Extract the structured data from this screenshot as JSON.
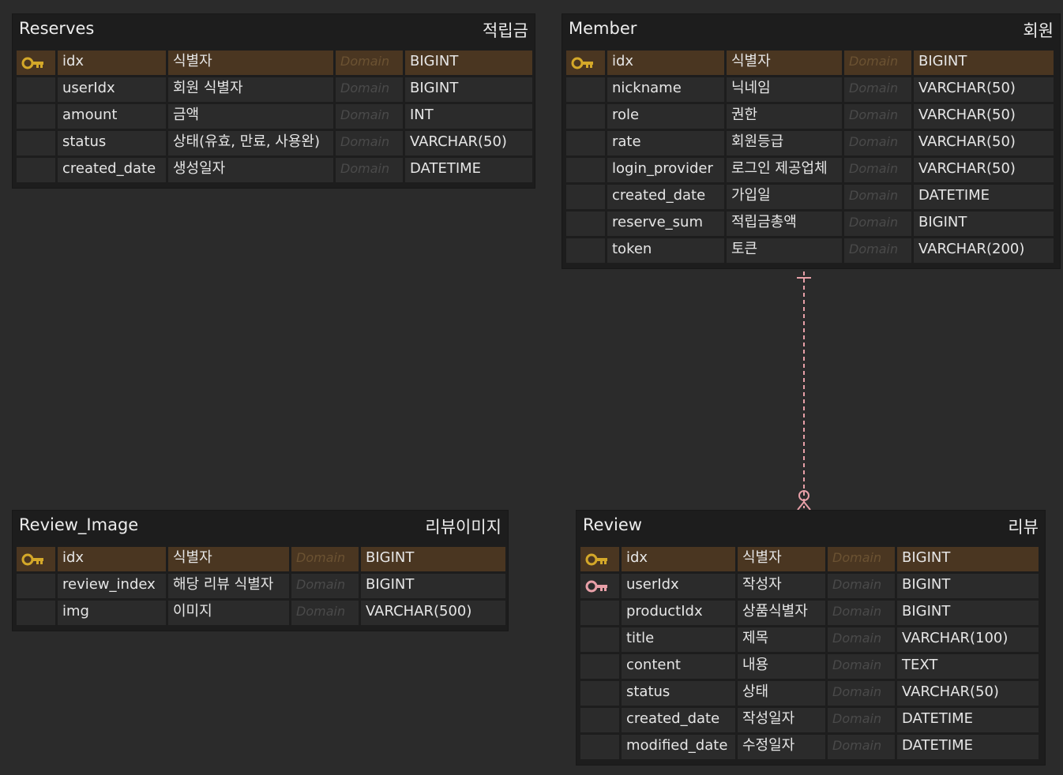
{
  "entities": {
    "reserves": {
      "name": "Reserves",
      "logical_name": "적립금",
      "columns": [
        {
          "name": "idx",
          "logical": "식별자",
          "domain": "Domain",
          "type": "BIGINT",
          "key": "pk"
        },
        {
          "name": "userIdx",
          "logical": "회원 식별자",
          "domain": "Domain",
          "type": "BIGINT",
          "key": ""
        },
        {
          "name": "amount",
          "logical": "금액",
          "domain": "Domain",
          "type": "INT",
          "key": ""
        },
        {
          "name": "status",
          "logical": "상태(유효, 만료, 사용완)",
          "domain": "Domain",
          "type": "VARCHAR(50)",
          "key": ""
        },
        {
          "name": "created_date",
          "logical": "생성일자",
          "domain": "Domain",
          "type": "DATETIME",
          "key": ""
        }
      ]
    },
    "member": {
      "name": "Member",
      "logical_name": "회원",
      "columns": [
        {
          "name": "idx",
          "logical": "식별자",
          "domain": "Domain",
          "type": "BIGINT",
          "key": "pk"
        },
        {
          "name": "nickname",
          "logical": "닉네임",
          "domain": "Domain",
          "type": "VARCHAR(50)",
          "key": ""
        },
        {
          "name": "role",
          "logical": "권한",
          "domain": "Domain",
          "type": "VARCHAR(50)",
          "key": ""
        },
        {
          "name": "rate",
          "logical": "회원등급",
          "domain": "Domain",
          "type": "VARCHAR(50)",
          "key": ""
        },
        {
          "name": "login_provider",
          "logical": "로그인 제공업체",
          "domain": "Domain",
          "type": "VARCHAR(50)",
          "key": ""
        },
        {
          "name": "created_date",
          "logical": "가입일",
          "domain": "Domain",
          "type": "DATETIME",
          "key": ""
        },
        {
          "name": "reserve_sum",
          "logical": "적립금총액",
          "domain": "Domain",
          "type": "BIGINT",
          "key": ""
        },
        {
          "name": "token",
          "logical": "토큰",
          "domain": "Domain",
          "type": "VARCHAR(200)",
          "key": ""
        }
      ]
    },
    "review_image": {
      "name": "Review_Image",
      "logical_name": "리뷰이미지",
      "columns": [
        {
          "name": "idx",
          "logical": "식별자",
          "domain": "Domain",
          "type": "BIGINT",
          "key": "pk"
        },
        {
          "name": "review_index",
          "logical": "해당 리뷰 식별자",
          "domain": "Domain",
          "type": "BIGINT",
          "key": ""
        },
        {
          "name": "img",
          "logical": "이미지",
          "domain": "Domain",
          "type": "VARCHAR(500)",
          "key": ""
        }
      ]
    },
    "review": {
      "name": "Review",
      "logical_name": "리뷰",
      "columns": [
        {
          "name": "idx",
          "logical": "식별자",
          "domain": "Domain",
          "type": "BIGINT",
          "key": "pk"
        },
        {
          "name": "userIdx",
          "logical": "작성자",
          "domain": "Domain",
          "type": "BIGINT",
          "key": "fk"
        },
        {
          "name": "productIdx",
          "logical": "상품식별자",
          "domain": "Domain",
          "type": "BIGINT",
          "key": ""
        },
        {
          "name": "title",
          "logical": "제목",
          "domain": "Domain",
          "type": "VARCHAR(100)",
          "key": ""
        },
        {
          "name": "content",
          "logical": "내용",
          "domain": "Domain",
          "type": "TEXT",
          "key": ""
        },
        {
          "name": "status",
          "logical": "상태",
          "domain": "Domain",
          "type": "VARCHAR(50)",
          "key": ""
        },
        {
          "name": "created_date",
          "logical": "작성일자",
          "domain": "Domain",
          "type": "DATETIME",
          "key": ""
        },
        {
          "name": "modified_date",
          "logical": "수정일자",
          "domain": "Domain",
          "type": "DATETIME",
          "key": ""
        }
      ]
    }
  },
  "relations": [
    {
      "from": "member",
      "to": "review",
      "cardinality": "one-to-zero-or-many",
      "color": "#e8a0a8"
    }
  ],
  "colors": {
    "pk_icon": "#d4a829",
    "fk_icon": "#e8a0a8",
    "pk_row": "#4a3621",
    "canvas": "#2b2b2b"
  }
}
